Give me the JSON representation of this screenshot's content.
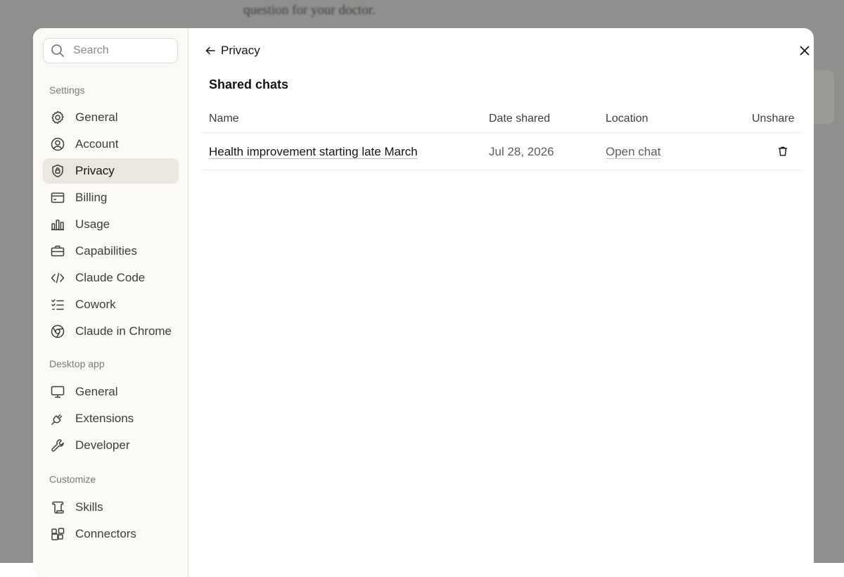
{
  "background": {
    "text": "question for your doctor."
  },
  "search": {
    "placeholder": "Search"
  },
  "sidebar": {
    "sections": [
      {
        "label": "Settings",
        "items": [
          {
            "label": "General",
            "icon": "gear-icon"
          },
          {
            "label": "Account",
            "icon": "user-circle-icon"
          },
          {
            "label": "Privacy",
            "icon": "shield-icon",
            "active": true
          },
          {
            "label": "Billing",
            "icon": "credit-card-icon"
          },
          {
            "label": "Usage",
            "icon": "bar-chart-icon"
          },
          {
            "label": "Capabilities",
            "icon": "briefcase-icon"
          },
          {
            "label": "Claude Code",
            "icon": "code-icon"
          },
          {
            "label": "Cowork",
            "icon": "checklist-icon"
          },
          {
            "label": "Claude in Chrome",
            "icon": "globe-icon"
          }
        ]
      },
      {
        "label": "Desktop app",
        "items": [
          {
            "label": "General",
            "icon": "monitor-icon"
          },
          {
            "label": "Extensions",
            "icon": "plug-icon"
          },
          {
            "label": "Developer",
            "icon": "wrench-icon"
          }
        ]
      },
      {
        "label": "Customize",
        "items": [
          {
            "label": "Skills",
            "icon": "scroll-icon"
          },
          {
            "label": "Connectors",
            "icon": "connectors-icon"
          }
        ]
      }
    ]
  },
  "header": {
    "title": "Privacy"
  },
  "shared_chats": {
    "title": "Shared chats",
    "columns": [
      "Name",
      "Date shared",
      "Location",
      "Unshare"
    ],
    "rows": [
      {
        "name": "Health improvement starting late March",
        "date": "Jul 28, 2026",
        "location": "Open chat"
      }
    ]
  },
  "colors": {
    "accent_active_bg": "#e9e7e0",
    "sidebar_bg": "#faf9f5",
    "text_primary": "#141413",
    "text_secondary": "#5e5d59"
  }
}
